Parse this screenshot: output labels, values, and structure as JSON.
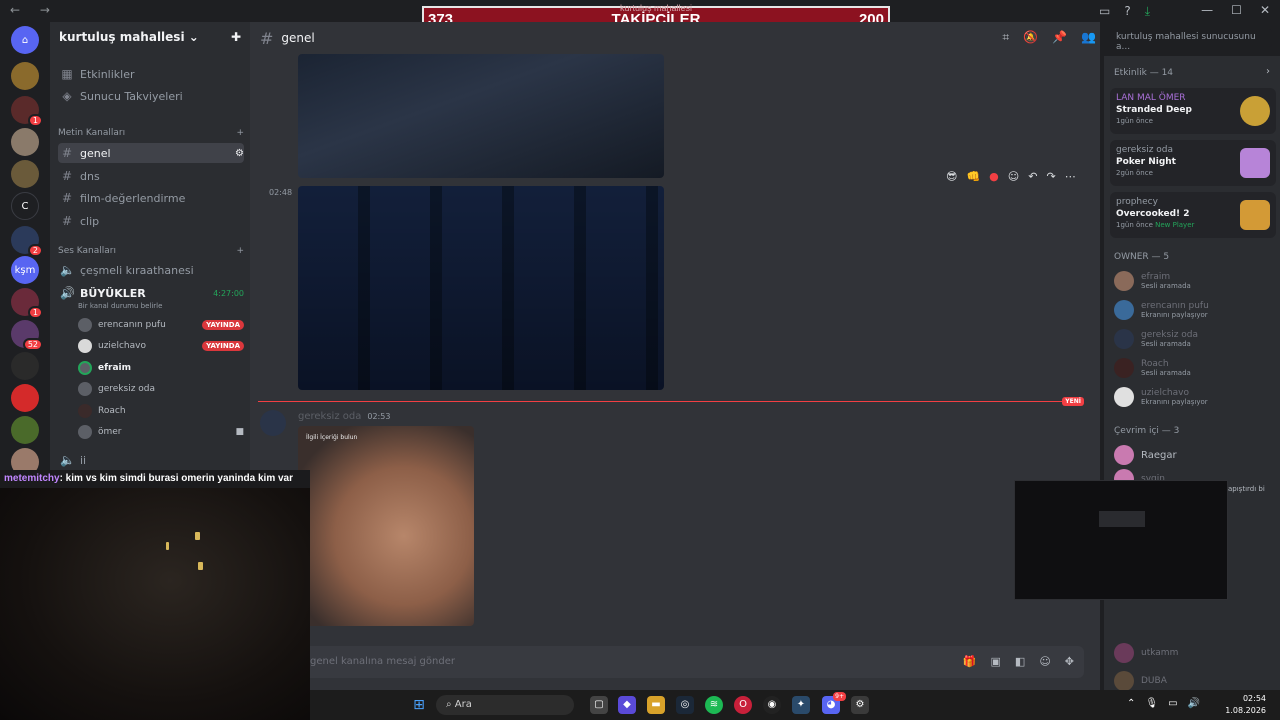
{
  "banner": {
    "left": "373",
    "title": "TAKİPÇİLER",
    "right": "200",
    "ghost": "kurtuluş mahallesi"
  },
  "server": {
    "name": "kurtuluş mahallesi"
  },
  "sidebar": {
    "top": [
      {
        "label": "Etkinlikler",
        "icon": "calendar-icon"
      },
      {
        "label": "Sunucu Takviyeleri",
        "icon": "boost-icon"
      }
    ],
    "text_category": "Metin Kanalları",
    "text_channels": [
      "genel",
      "dns",
      "film-değerlendirme",
      "clip"
    ],
    "voice_category": "Ses Kanalları",
    "voice_channels": [
      "çeşmeli kıraathanesi",
      "BÜYÜKLER",
      "ii"
    ],
    "voice_timer": "4:27:00",
    "voice_status": "Bir kanal durumu belirle",
    "voice_users": [
      {
        "name": "erencanın pufu",
        "live": "YAYINDA"
      },
      {
        "name": "uzielchavo",
        "live": "YAYINDA"
      },
      {
        "name": "efraim",
        "live": ""
      },
      {
        "name": "gereksiz oda",
        "live": ""
      },
      {
        "name": "Roach",
        "live": ""
      },
      {
        "name": "ömer",
        "live": ""
      }
    ]
  },
  "rail": {
    "servers": [
      "",
      "",
      "",
      "",
      "C",
      "",
      "kşm",
      "",
      "",
      "",
      "",
      "",
      ""
    ],
    "badges": [
      "1",
      "2",
      "1",
      "52"
    ]
  },
  "channel": {
    "name": "genel"
  },
  "search": {
    "placeholder": "kurtuluş mahallesi sunucusunu a..."
  },
  "messages": {
    "time1": "02:48",
    "new_label": "YENİ",
    "author": "gereksiz oda",
    "time2": "02:53",
    "image_caption": "İlgili İçeriği bulun"
  },
  "composer": {
    "placeholder": "genel kanalına mesaj gönder"
  },
  "members": {
    "activity_header": "Etkinlik — 14",
    "activities": [
      {
        "who": "LAN MAL ÖMER",
        "game": "Stranded Deep",
        "when": "1gün önce",
        "extra": ""
      },
      {
        "who": "gereksiz oda",
        "game": "Poker Night",
        "when": "2gün önce",
        "extra": ""
      },
      {
        "who": "prophecy",
        "game": "Overcooked! 2",
        "when": "1gün önce",
        "extra": "New Player"
      }
    ],
    "owner_header": "OWNER — 5",
    "owners": [
      {
        "name": "efraim",
        "status": "Sesli aramada"
      },
      {
        "name": "erencanın pufu",
        "status": "Ekranını paylaşıyor"
      },
      {
        "name": "gereksiz oda",
        "status": "Sesli aramada"
      },
      {
        "name": "Roach",
        "status": "Sesli aramada"
      },
      {
        "name": "uzielchavo",
        "status": "Ekranını paylaşıyor"
      }
    ],
    "online_header": "Çevrim içi — 3",
    "online": [
      {
        "name": "Raegar"
      },
      {
        "name": "svgin"
      }
    ],
    "bottom": [
      {
        "name": "utkamm"
      },
      {
        "name": "DUBA"
      }
    ],
    "pip_trail": "apıştırdı bi"
  },
  "overlay": {
    "chat_user": "metemitchy",
    "chat_text": ": kim vs kim simdi burasi omerin yaninda kim var"
  },
  "taskbar": {
    "search": "Ara",
    "time": "02:54",
    "date": "1.08.2026",
    "discord_badge": "9+"
  },
  "colors": {
    "accent": "#5865f2",
    "live": "#da373c",
    "banner": "#8c1220",
    "online": "#23a55a"
  }
}
